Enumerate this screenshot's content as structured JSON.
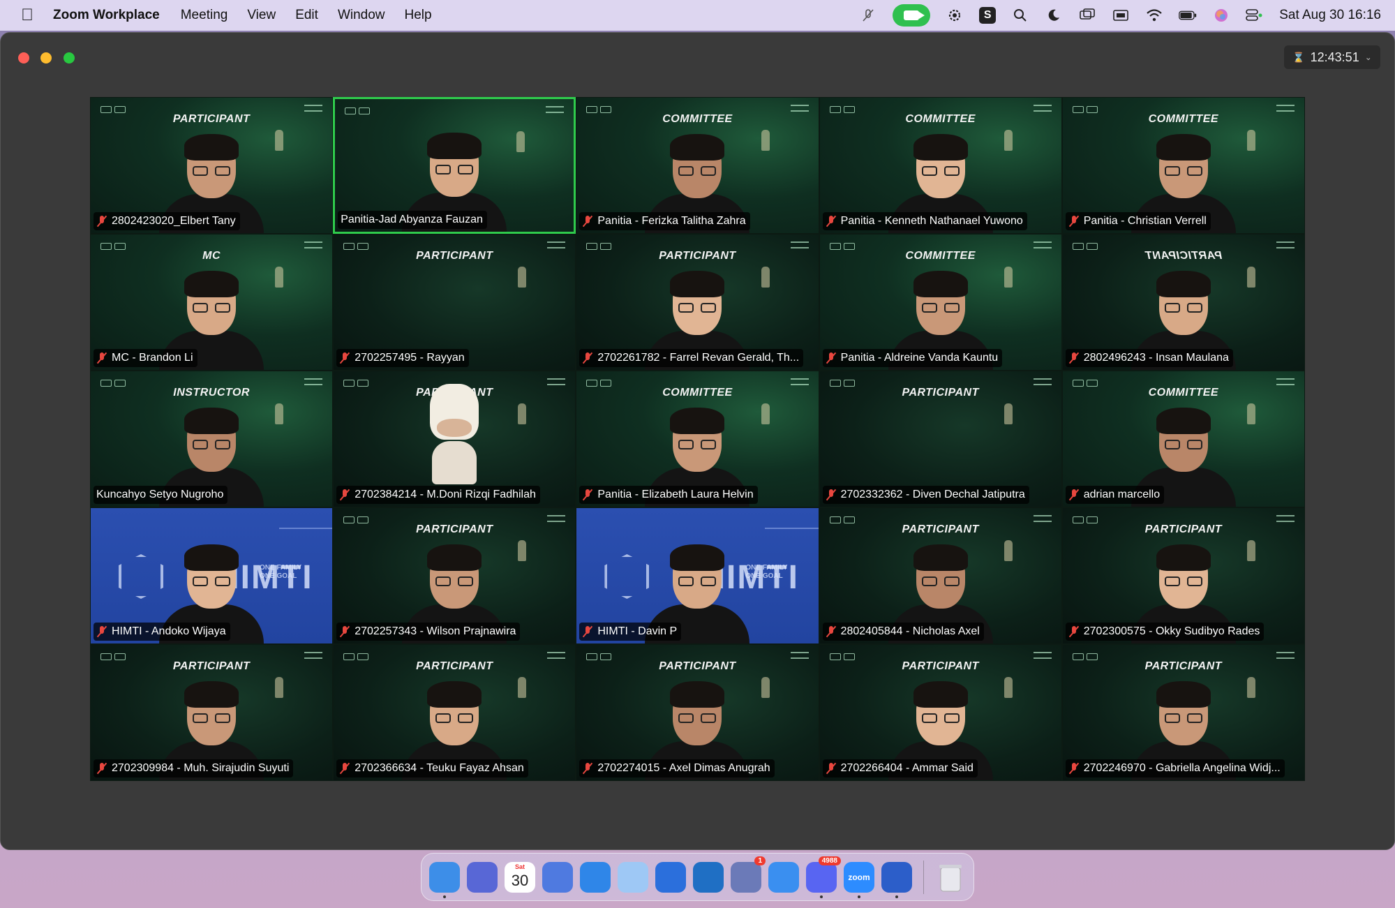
{
  "menubar": {
    "app_name": "Zoom Workplace",
    "menus": [
      "Meeting",
      "View",
      "Edit",
      "Window",
      "Help"
    ],
    "datetime": "Sat Aug 30  16:16",
    "status_icons": [
      "mic-muted-icon",
      "zoom-video-icon",
      "gear-badge-icon",
      "s-app-icon",
      "search-icon",
      "moon-icon",
      "screen-mirror-icon",
      "display-icon",
      "wifi-icon",
      "battery-icon",
      "siri-icon",
      "control-center-icon"
    ]
  },
  "window": {
    "timer": "12:43:51"
  },
  "gallery": {
    "tiles": [
      {
        "role": "PARTICIPANT",
        "name": "2802423020_Elbert Tany",
        "muted": true,
        "style": "green"
      },
      {
        "role": "",
        "name": "Panitia-Jad Abyanza Fauzan",
        "muted": false,
        "style": "green",
        "active": true
      },
      {
        "role": "COMMITTEE",
        "name": "Panitia - Ferizka Talitha Zahra",
        "muted": true,
        "style": "green"
      },
      {
        "role": "COMMITTEE",
        "name": "Panitia - Kenneth Nathanael Yuwono",
        "muted": true,
        "style": "green"
      },
      {
        "role": "COMMITTEE",
        "name": "Panitia - Christian Verrell",
        "muted": true,
        "style": "green"
      },
      {
        "role": "MC",
        "name": "MC - Brandon Li",
        "muted": true,
        "style": "green"
      },
      {
        "role": "PARTICIPANT",
        "name": "2702257495 - Rayyan",
        "muted": true,
        "style": "dark",
        "nocam": true
      },
      {
        "role": "PARTICIPANT",
        "name": "2702261782 - Farrel Revan Gerald, Th...",
        "muted": true,
        "style": "dark"
      },
      {
        "role": "COMMITTEE",
        "name": "Panitia - Aldreine Vanda Kauntu",
        "muted": true,
        "style": "green"
      },
      {
        "role": "PARTICIPANT",
        "name": "2802496243 - Insan Maulana",
        "muted": true,
        "style": "dark",
        "mirrored": true
      },
      {
        "role": "INSTRUCTOR",
        "name": "Kuncahyo Setyo Nugroho",
        "muted": false,
        "style": "green"
      },
      {
        "role": "PARTICIPANT",
        "name": "2702384214 - M.Doni Rizqi Fadhilah",
        "muted": true,
        "style": "dark",
        "cow": true
      },
      {
        "role": "COMMITTEE",
        "name": "Panitia - Elizabeth Laura Helvin",
        "muted": true,
        "style": "green"
      },
      {
        "role": "PARTICIPANT",
        "name": "2702332362 - Diven Dechal Jatiputra",
        "muted": true,
        "style": "dark",
        "nocam": true
      },
      {
        "role": "COMMITTEE",
        "name": "adrian marcello",
        "muted": true,
        "style": "green"
      },
      {
        "role": "",
        "name": "HIMTI - Andoko Wijaya",
        "muted": true,
        "style": "himti"
      },
      {
        "role": "PARTICIPANT",
        "name": "2702257343 - Wilson Prajnawira",
        "muted": true,
        "style": "dark"
      },
      {
        "role": "",
        "name": "HIMTI - Davin P",
        "muted": true,
        "style": "himti"
      },
      {
        "role": "PARTICIPANT",
        "name": "2802405844 - Nicholas Axel",
        "muted": true,
        "style": "dark"
      },
      {
        "role": "PARTICIPANT",
        "name": "2702300575 - Okky Sudibyo Rades",
        "muted": true,
        "style": "dark"
      },
      {
        "role": "PARTICIPANT",
        "name": "2702309984 - Muh. Sirajudin Suyuti",
        "muted": true,
        "style": "dark"
      },
      {
        "role": "PARTICIPANT",
        "name": "2702366634 - Teuku Fayaz Ahsan",
        "muted": true,
        "style": "dark"
      },
      {
        "role": "PARTICIPANT",
        "name": "2702274015 - Axel Dimas Anugrah",
        "muted": true,
        "style": "dark"
      },
      {
        "role": "PARTICIPANT",
        "name": "2702266404 - Ammar Said",
        "muted": true,
        "style": "dark"
      },
      {
        "role": "PARTICIPANT",
        "name": "2702246970 - Gabriella Angelina Widj...",
        "muted": true,
        "style": "dark"
      }
    ]
  },
  "himti": {
    "wordmark": "HIMTI",
    "tagline_1": "ONE FAMILY",
    "tagline_2": "ONE GOAL"
  },
  "dock": {
    "apps": [
      {
        "icon": "finder-icon",
        "color": "#3d8ee8",
        "running": true
      },
      {
        "icon": "launchpad-icon",
        "color": "#5867d6"
      },
      {
        "icon": "calendar-icon",
        "color": "#ffffff",
        "label": "30",
        "sub": "Sat"
      },
      {
        "icon": "notes-icon",
        "color": "#4f7ae0"
      },
      {
        "icon": "safari-icon",
        "color": "#2f86e8"
      },
      {
        "icon": "messages-icon",
        "color": "#9ec8f5"
      },
      {
        "icon": "screen-capture-icon",
        "color": "#2b6fdc"
      },
      {
        "icon": "vscode-icon",
        "color": "#1f6fc4"
      },
      {
        "icon": "system-settings-icon",
        "color": "#6b7ab8",
        "badge": "1"
      },
      {
        "icon": "app-store-icon",
        "color": "#3a8ff0"
      },
      {
        "icon": "discord-icon",
        "color": "#5865f2",
        "badge": "4988",
        "running": true
      },
      {
        "icon": "zoom-icon",
        "color": "#2d8cff",
        "label": "zoom",
        "running": true
      },
      {
        "icon": "figma-icon",
        "color": "#2c5ec9",
        "running": true
      }
    ],
    "trash_icon": "trash-icon"
  }
}
